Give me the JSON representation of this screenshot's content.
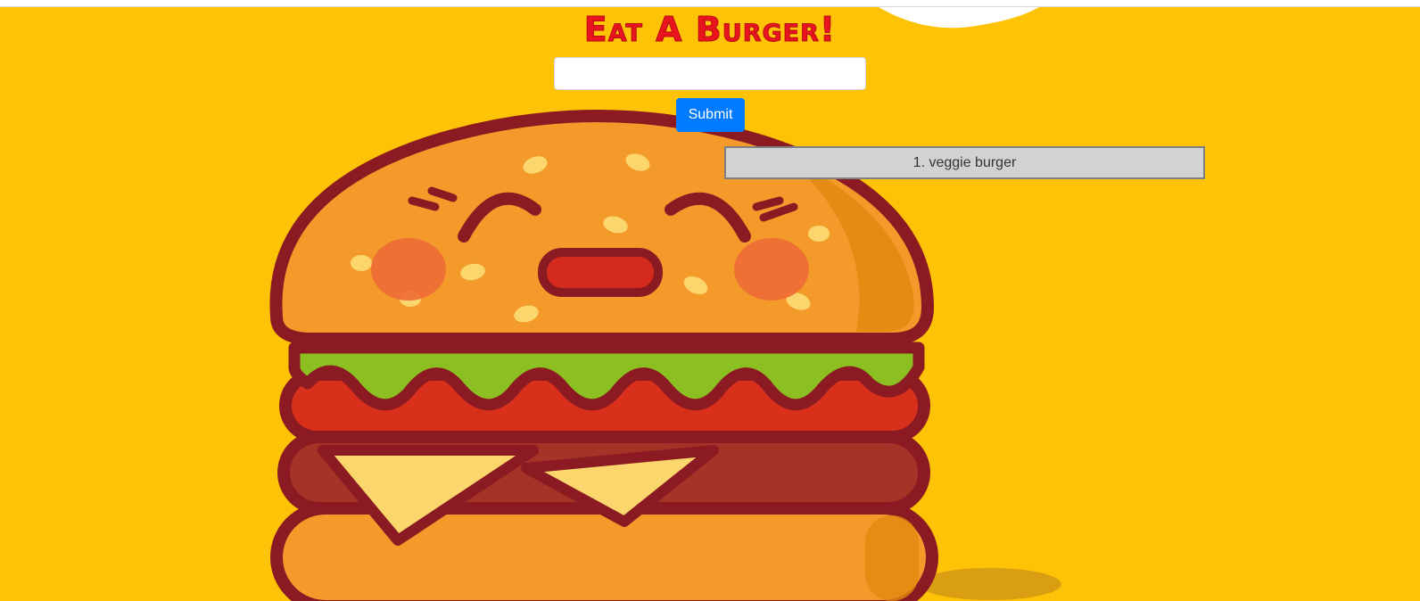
{
  "page": {
    "title": "Eat A Burger!",
    "background_color": "#fec207",
    "title_color": "#e8141e"
  },
  "form": {
    "input_value": "",
    "input_placeholder": "",
    "submit_label": "Submit",
    "submit_color": "#007bff"
  },
  "burgers": [
    {
      "label": "1. veggie burger"
    }
  ],
  "illustration": {
    "icon": "smiling-burger-illustration"
  }
}
